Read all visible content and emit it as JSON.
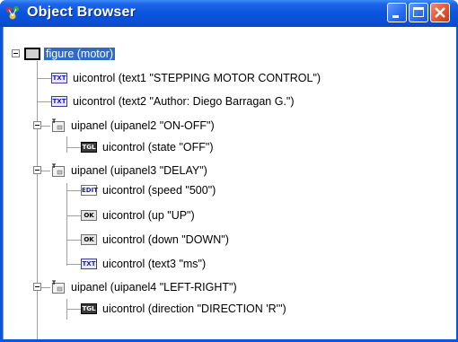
{
  "window": {
    "title": "Object Browser"
  },
  "tree": {
    "root_label": "figure (motor)",
    "nodes": [
      {
        "label": "uicontrol (text1 \"STEPPING MOTOR CONTROL\")",
        "icon": "text-control-icon",
        "badge": "TXT"
      },
      {
        "label": "uicontrol (text2 \"Author: Diego Barragan G.\")",
        "icon": "text-control-icon",
        "badge": "TXT"
      },
      {
        "label": "uipanel (uipanel2 \"ON-OFF\")",
        "icon": "panel-icon"
      },
      {
        "label": "uicontrol (state \"OFF\")",
        "icon": "toggle-control-icon",
        "badge": "TGL"
      },
      {
        "label": "uipanel (uipanel3 \"DELAY\")",
        "icon": "panel-icon"
      },
      {
        "label": "uicontrol (speed \"500\")",
        "icon": "edit-control-icon",
        "badge": "EDIT"
      },
      {
        "label": "uicontrol (up \"UP\")",
        "icon": "pushbutton-control-icon",
        "badge": "OK"
      },
      {
        "label": "uicontrol (down \"DOWN\")",
        "icon": "pushbutton-control-icon",
        "badge": "OK"
      },
      {
        "label": "uicontrol (text3 \"ms\")",
        "icon": "text-control-icon",
        "badge": "TXT"
      },
      {
        "label": "uipanel (uipanel4 \"LEFT-RIGHT\")",
        "icon": "panel-icon"
      },
      {
        "label": "uicontrol (direction \"DIRECTION 'R'\")",
        "icon": "toggle-control-icon",
        "badge": "TGL"
      }
    ]
  }
}
